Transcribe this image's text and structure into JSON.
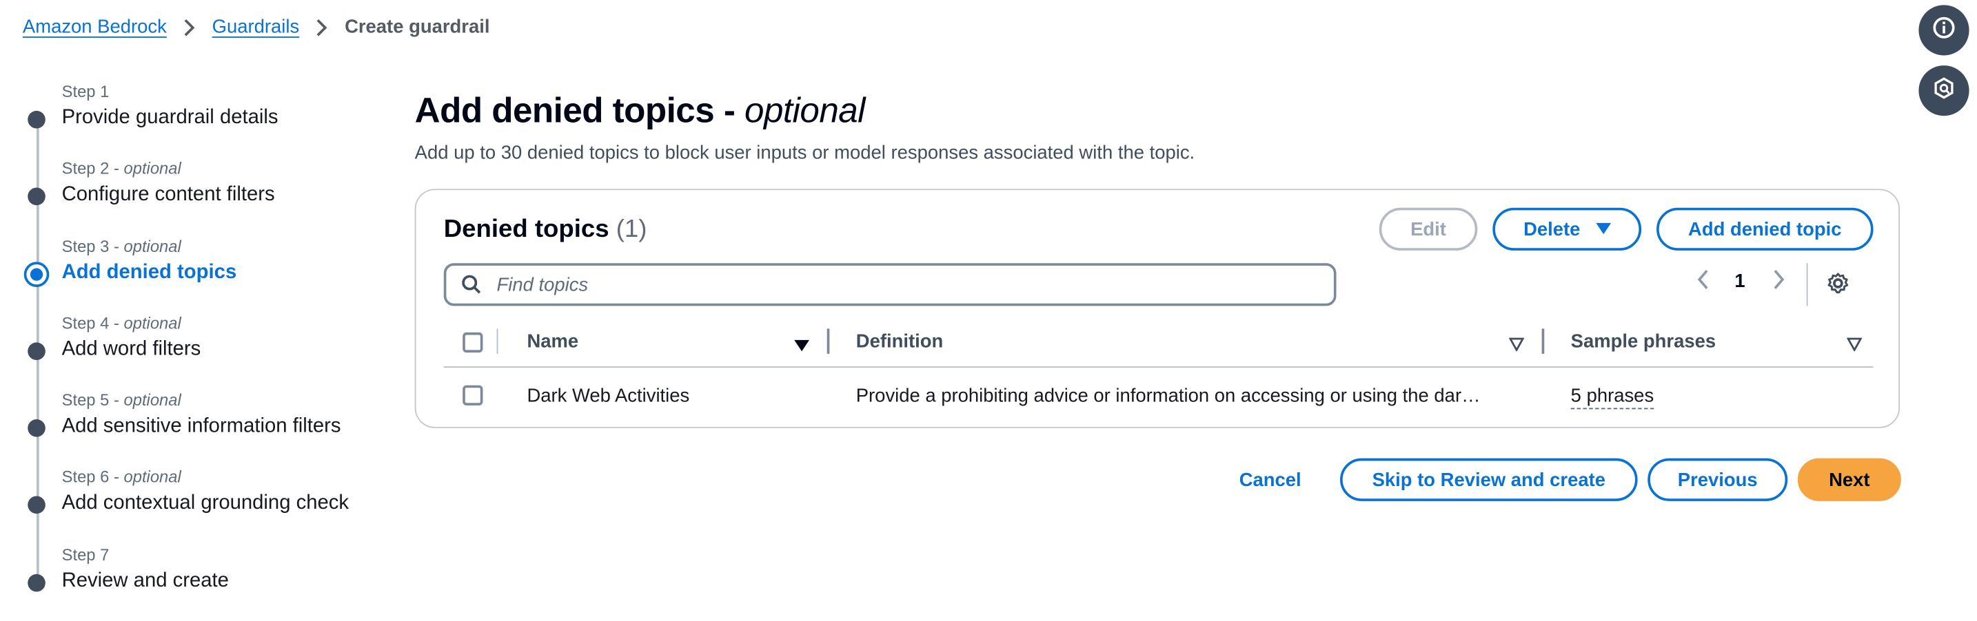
{
  "breadcrumb": {
    "items": [
      "Amazon Bedrock",
      "Guardrails"
    ],
    "current": "Create guardrail"
  },
  "side_buttons": [
    "info-icon",
    "feedback-icon"
  ],
  "steps": [
    {
      "label": "Step 1",
      "optional": "",
      "title": "Provide guardrail details"
    },
    {
      "label": "Step 2",
      "optional": "optional",
      "title": "Configure content filters"
    },
    {
      "label": "Step 3",
      "optional": "optional",
      "title": "Add denied topics"
    },
    {
      "label": "Step 4",
      "optional": "optional",
      "title": "Add word filters"
    },
    {
      "label": "Step 5",
      "optional": "optional",
      "title": "Add sensitive information filters"
    },
    {
      "label": "Step 6",
      "optional": "optional",
      "title": "Add contextual grounding check"
    },
    {
      "label": "Step 7",
      "optional": "",
      "title": "Review and create"
    }
  ],
  "active_step": 3,
  "page": {
    "title": "Add denied topics - ",
    "title_optional": "optional",
    "description": "Add up to 30 denied topics to block user inputs or model responses associated with the topic."
  },
  "table": {
    "title": "Denied topics",
    "count": "(1)",
    "buttons": {
      "edit": "Edit",
      "delete": "Delete",
      "add": "Add denied topic"
    },
    "search_placeholder": "Find topics",
    "page_number": "1",
    "columns": [
      "Name",
      "Definition",
      "Sample phrases"
    ],
    "rows": [
      {
        "name": "Dark Web Activities",
        "definition": "Provide a prohibiting advice or information on accessing or using the dar…",
        "phrases": "5 phrases"
      }
    ]
  },
  "footer": {
    "cancel": "Cancel",
    "skip": "Skip to Review and create",
    "previous": "Previous",
    "next": "Next"
  },
  "colors": {
    "accent": "#0972d3",
    "primary_button": "#f5a440",
    "step_dot": "#414d5c"
  }
}
